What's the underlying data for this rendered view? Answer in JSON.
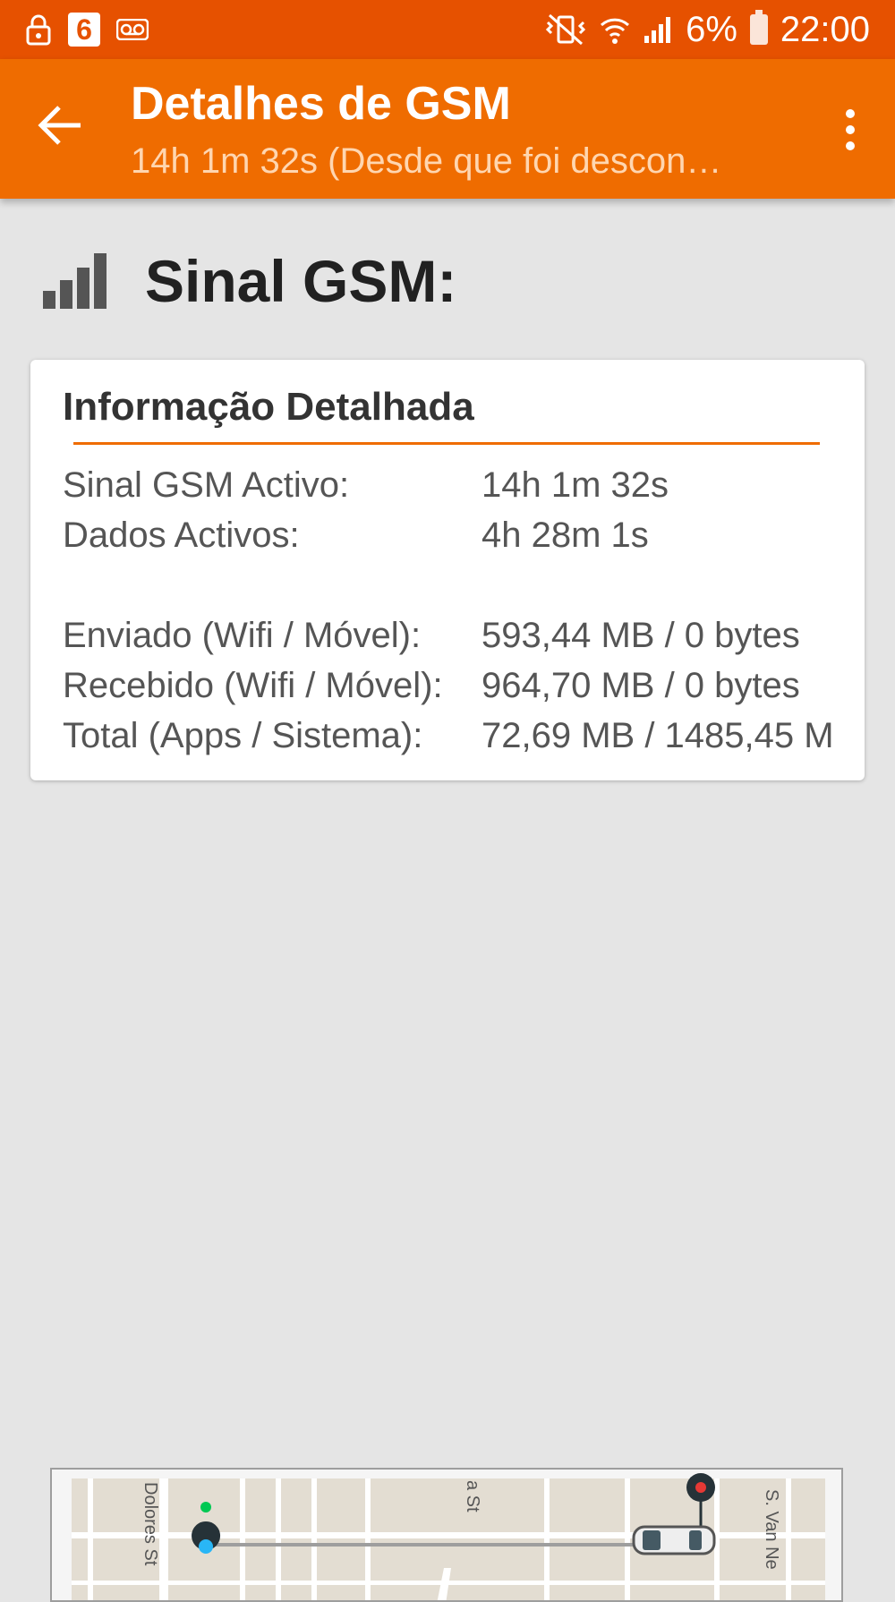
{
  "status_bar": {
    "notification_badge": "6",
    "battery_percent": "6%",
    "time": "22:00",
    "icons": [
      "lock-icon",
      "voicemail-icon",
      "vibrate-icon",
      "wifi-icon",
      "signal-icon",
      "battery-icon"
    ]
  },
  "app_bar": {
    "title": "Detalhes de GSM",
    "subtitle": "14h 1m 32s (Desde que foi descon…",
    "icons": [
      "back-arrow-icon",
      "more-vert-icon"
    ]
  },
  "section": {
    "title": "Sinal GSM:",
    "icon": "signal-bars-icon"
  },
  "card": {
    "title": "Informação Detalhada",
    "rows": [
      {
        "label": "Sinal GSM Activo:",
        "value": "14h 1m 32s"
      },
      {
        "label": "Dados Activos:",
        "value": "4h 28m 1s"
      },
      {
        "label": "Enviado (Wifi / Móvel):",
        "value": "593,44 MB / 0 bytes"
      },
      {
        "label": "Recebido (Wifi / Móvel):",
        "value": "964,70 MB / 0 bytes"
      },
      {
        "label": "Total (Apps / Sistema):",
        "value": "72,69 MB / 1485,45 M"
      }
    ]
  },
  "map_ad": {
    "streets": [
      "Dolores St",
      "a St",
      "S. Van Ne"
    ]
  },
  "colors": {
    "status_bar": "#e65100",
    "app_bar": "#ef6c00",
    "accent": "#ef6c00",
    "background": "#e5e5e5"
  }
}
